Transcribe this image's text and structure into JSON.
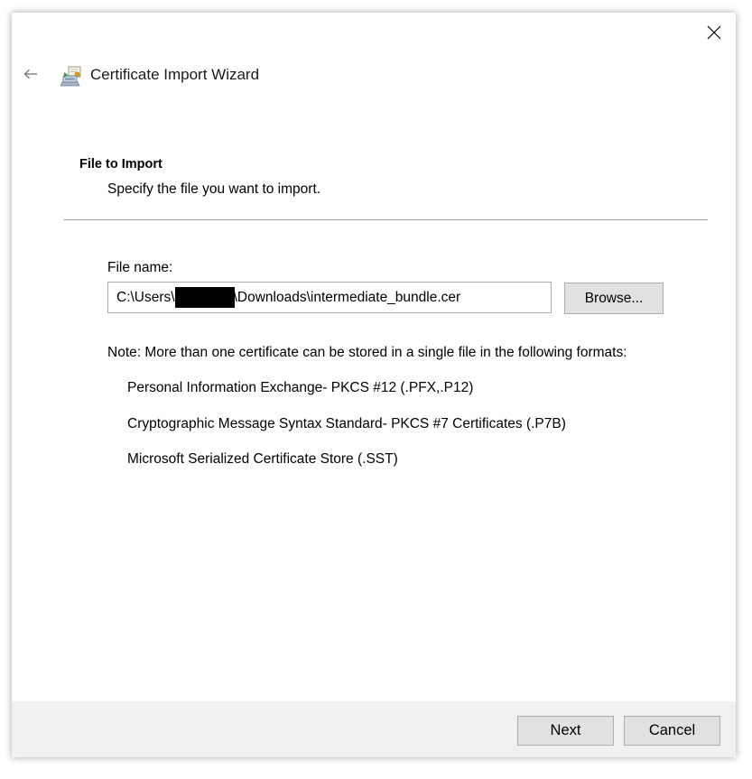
{
  "window": {
    "title": "Certificate Import Wizard",
    "close_icon": "close-icon",
    "back_icon": "back-arrow-icon",
    "wizard_icon": "certificate-wizard-icon"
  },
  "section": {
    "heading": "File to Import",
    "subheading": "Specify the file you want to import."
  },
  "file": {
    "label": "File name:",
    "value_prefix": "C:\\Users\\",
    "value_suffix": "\\Downloads\\intermediate_bundle.cer",
    "browse_label": "Browse..."
  },
  "note": "Note:  More than one certificate can be stored in a single file in the following formats:",
  "formats": [
    "Personal Information Exchange- PKCS #12 (.PFX,.P12)",
    "Cryptographic Message Syntax Standard- PKCS #7 Certificates (.P7B)",
    "Microsoft Serialized Certificate Store (.SST)"
  ],
  "footer": {
    "next_label": "Next",
    "cancel_label": "Cancel"
  }
}
